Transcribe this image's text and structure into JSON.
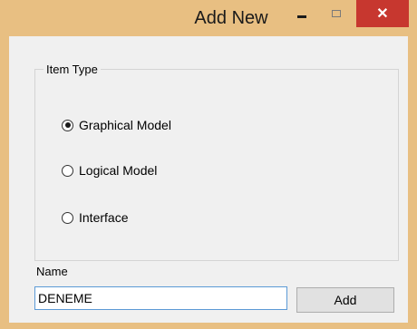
{
  "window": {
    "title": "Add New",
    "close_glyph": "✕",
    "frame_color": "#e8bf82",
    "close_color": "#c7372f"
  },
  "groupbox": {
    "legend": "Item Type",
    "options": [
      {
        "label": "Graphical Model",
        "checked": true
      },
      {
        "label": "Logical Model",
        "checked": false
      },
      {
        "label": "Interface",
        "checked": false
      }
    ]
  },
  "name_field": {
    "label": "Name",
    "value": "DENEME"
  },
  "add_button": {
    "label": "Add"
  }
}
